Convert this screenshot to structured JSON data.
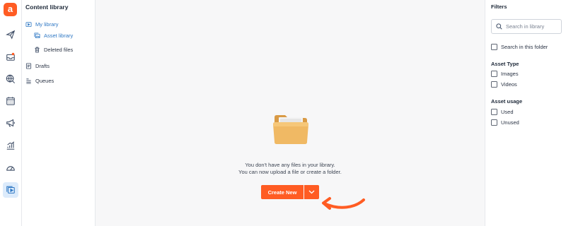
{
  "rail": {
    "logo_letter": "a",
    "icons": [
      "paper-plane-icon",
      "inbox-icon",
      "globe-search-icon",
      "calendar-icon",
      "megaphone-icon",
      "bar-chart-icon",
      "gauge-icon",
      "media-library-icon"
    ],
    "active": "media-library-icon"
  },
  "nav": {
    "title": "Content library",
    "my_library": "My library",
    "asset_library": "Asset library",
    "deleted_files": "Deleted files",
    "drafts": "Drafts",
    "queues": "Queues"
  },
  "main": {
    "empty_line1": "You don't have any files in your library.",
    "empty_line2": "You can now upload a file or create a folder.",
    "create_new": "Create New"
  },
  "filters": {
    "title": "Filters",
    "search_placeholder": "Search in library",
    "search_in_folder": "Search in this folder",
    "asset_type_title": "Asset Type",
    "images": "Images",
    "videos": "Videos",
    "asset_usage_title": "Asset usage",
    "used": "Used",
    "unused": "Unused"
  },
  "colors": {
    "brand": "#ff5c23",
    "link_blue": "#2f78c4",
    "active_bg": "#dcebfb"
  }
}
